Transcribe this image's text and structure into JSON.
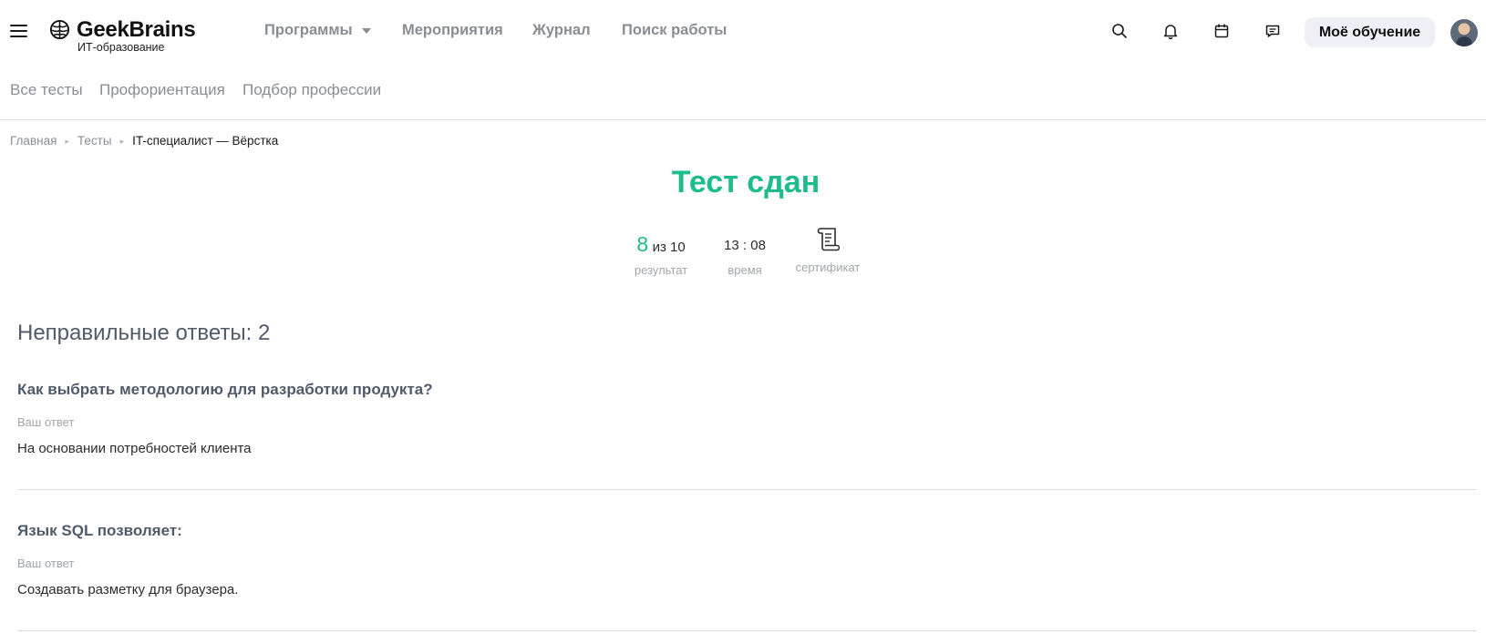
{
  "header": {
    "logo_text": "GeekBrains",
    "logo_subtitle": "ИТ-образование",
    "nav": [
      {
        "label": "Программы"
      },
      {
        "label": "Мероприятия"
      },
      {
        "label": "Журнал"
      },
      {
        "label": "Поиск работы"
      }
    ],
    "icons": [
      "search-icon",
      "bell-icon",
      "calendar-icon",
      "chat-icon"
    ],
    "my_learning_label": "Моё обучение"
  },
  "subnav": [
    {
      "label": "Все тесты"
    },
    {
      "label": "Профориентация"
    },
    {
      "label": "Подбор профессии"
    }
  ],
  "breadcrumbs": {
    "items": [
      "Главная",
      "Тесты"
    ],
    "current": "IT-специалист — Вёрстка"
  },
  "result": {
    "title": "Тест сдан",
    "score": "8",
    "score_total": "из 10",
    "score_label": "результат",
    "time": "13 : 08",
    "time_label": "время",
    "certificate_label": "сертификат",
    "certificate_icon": "certificate-icon"
  },
  "wrong_answers": {
    "title": "Неправильные ответы: 2",
    "items": [
      {
        "question": "Как выбрать методологию для разработки продукта?",
        "answer_label": "Ваш ответ",
        "answer": "На основании потребностей клиента"
      },
      {
        "question": "Язык SQL позволяет:",
        "answer_label": "Ваш ответ",
        "answer": "Создавать разметку для браузера."
      }
    ]
  },
  "colors": {
    "accent": "#1dbc8a",
    "nav_text": "#8a8d96",
    "heading_text": "#4f5a6b"
  }
}
